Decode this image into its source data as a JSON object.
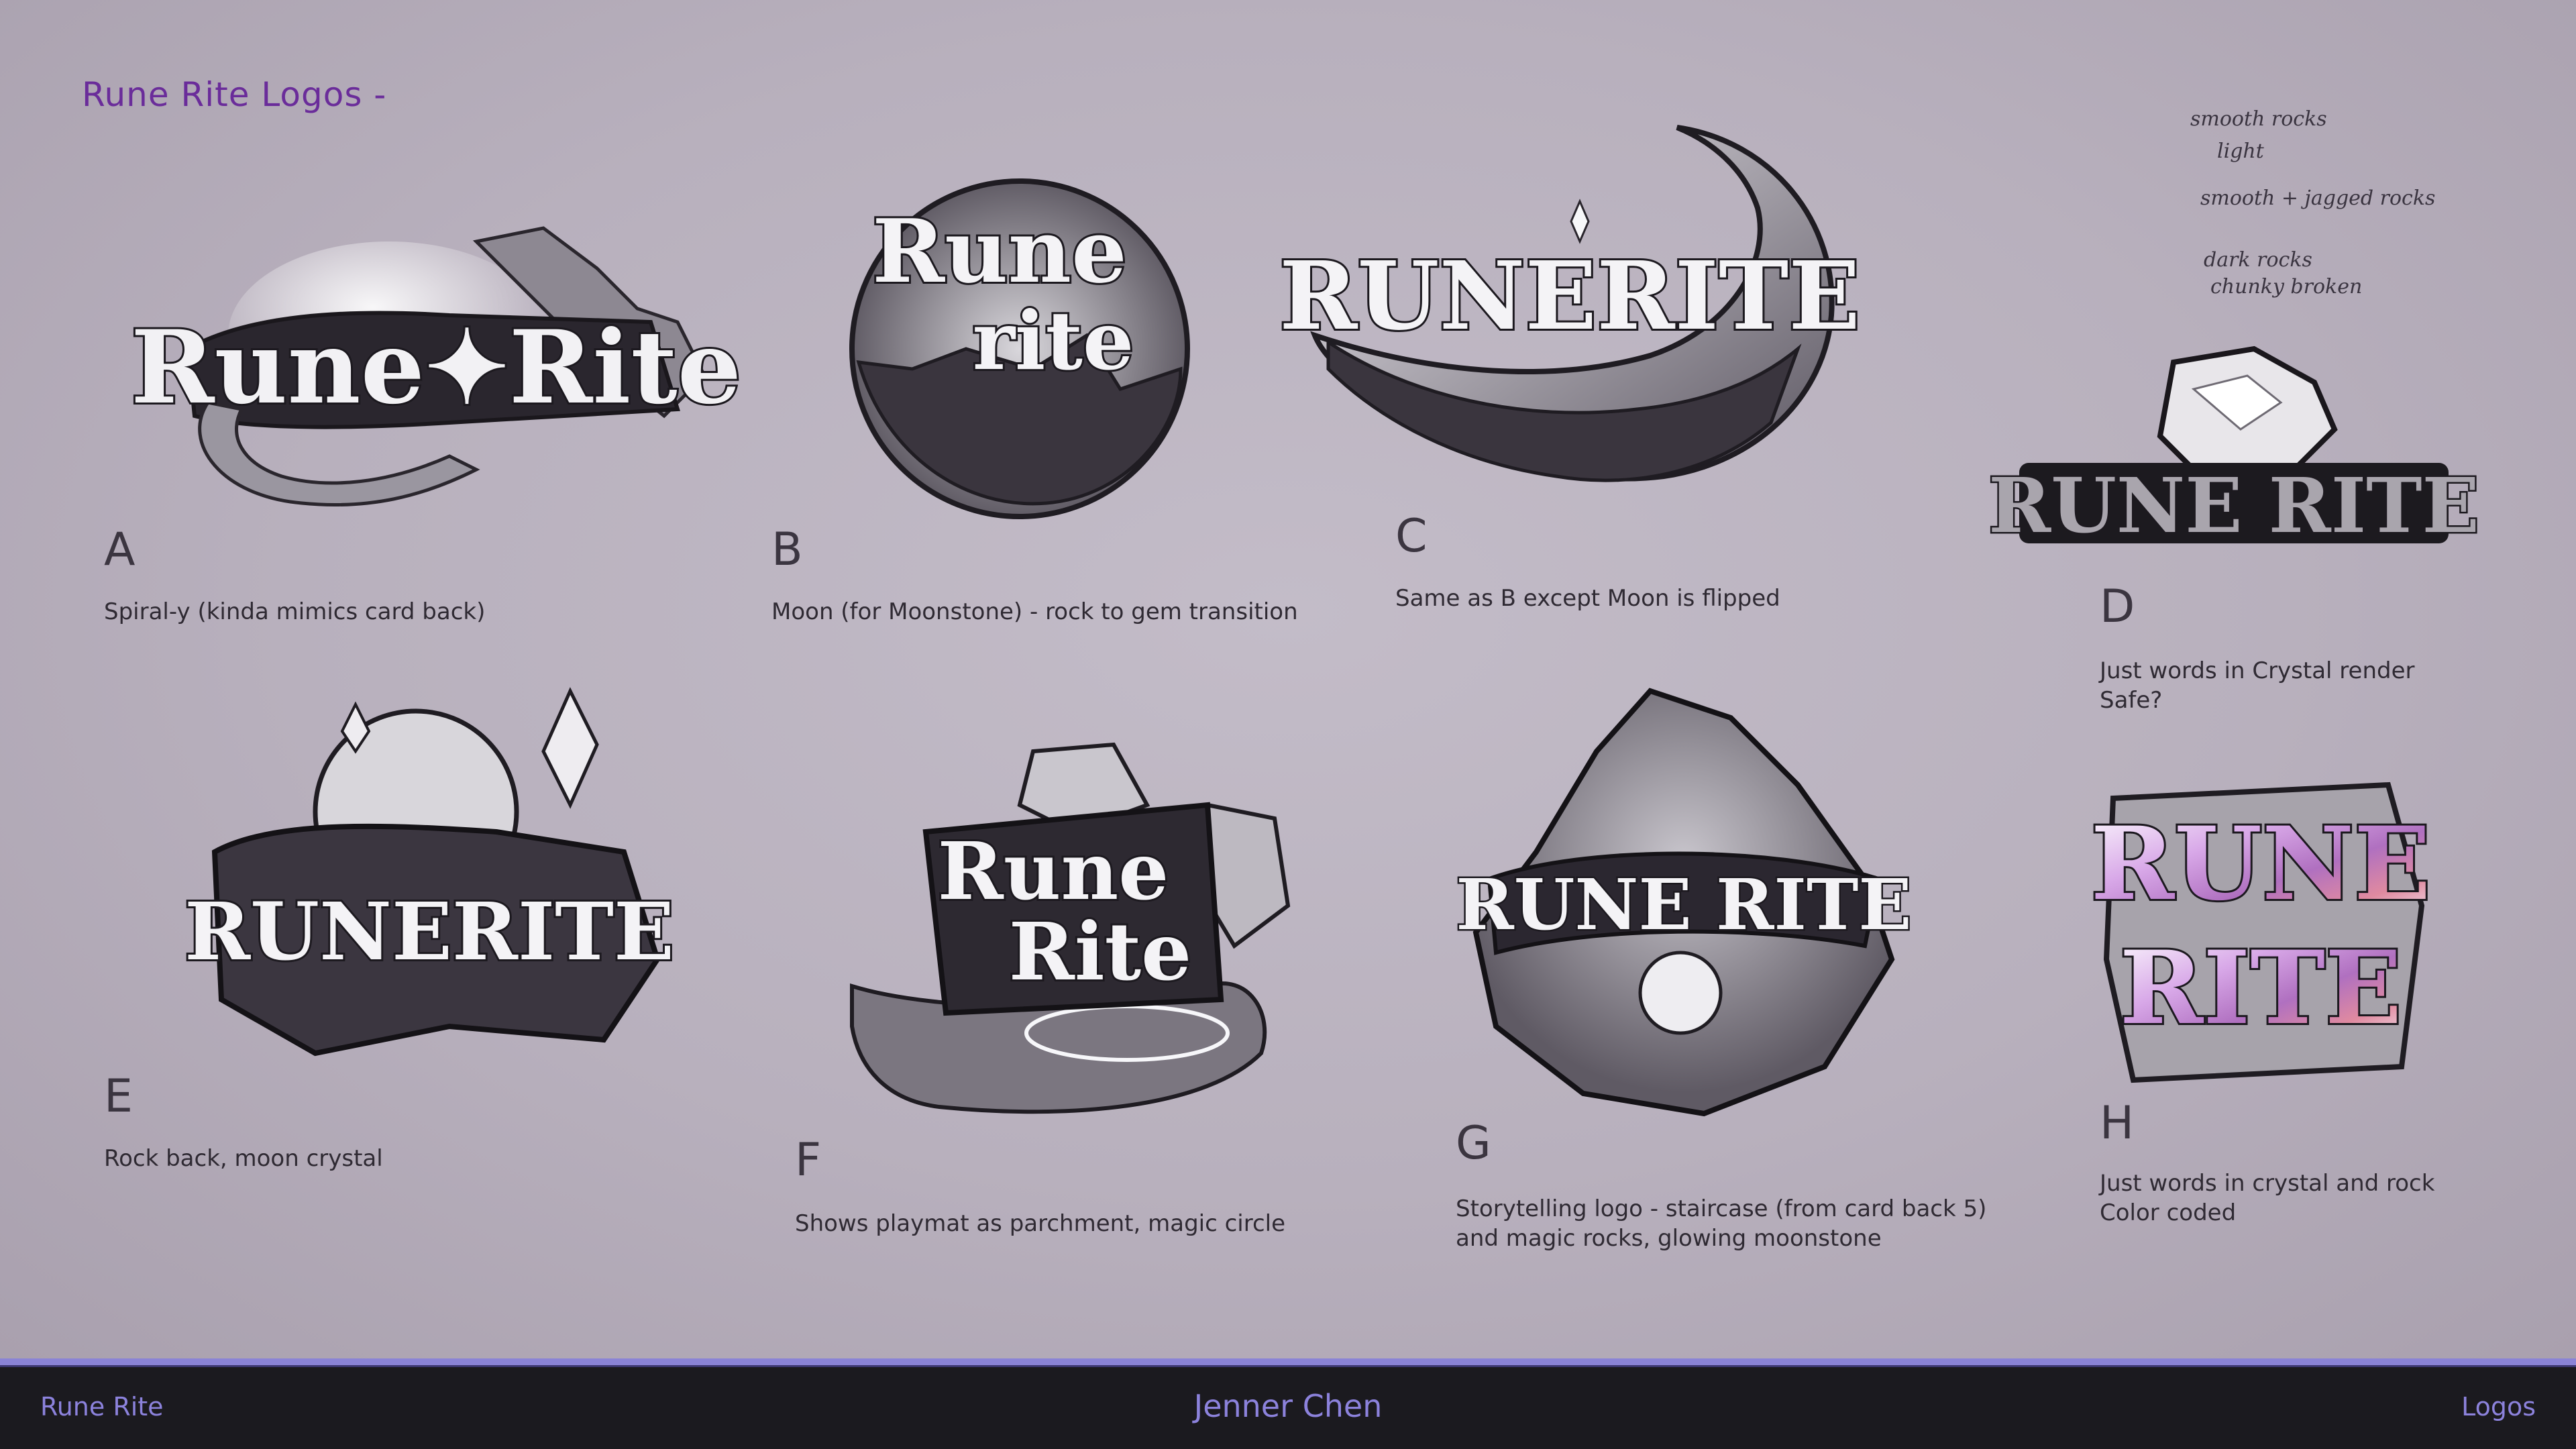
{
  "sheet": {
    "title": "Rune Rite Logos -",
    "concepts": [
      {
        "id": "A",
        "wordmark": "Rune✦Rite",
        "caption": [
          "Spiral-y (kinda mimics card back)"
        ]
      },
      {
        "id": "B",
        "wordmark_line1": "Rune",
        "wordmark_line2": "rite",
        "caption": [
          "Moon (for Moonstone) - rock to gem transition"
        ]
      },
      {
        "id": "C",
        "wordmark": "RUNERITE",
        "caption": [
          "Same as B except Moon is flipped"
        ]
      },
      {
        "id": "D",
        "wordmark": "RUNE RITE",
        "caption": [
          "Just words in Crystal render",
          "Safe?"
        ]
      },
      {
        "id": "E",
        "wordmark": "RUNERITE",
        "caption": [
          "Rock back, moon crystal"
        ]
      },
      {
        "id": "F",
        "wordmark_line1": "Rune",
        "wordmark_line2": "Rite",
        "caption": [
          "Shows playmat as parchment, magic circle"
        ]
      },
      {
        "id": "G",
        "wordmark": "RUNE RITE",
        "caption": [
          "Storytelling logo - staircase (from card back 5)",
          "and magic rocks, glowing moonstone"
        ]
      },
      {
        "id": "H",
        "wordmark_line1": "RUNE",
        "wordmark_line2": "RITE",
        "caption": [
          "Just words in crystal and rock",
          "Color coded"
        ]
      }
    ],
    "handwritten_notes": [
      "smooth rocks",
      "light",
      "smooth + jagged rocks",
      "dark rocks",
      "chunky broken"
    ]
  },
  "footer": {
    "left": "Rune Rite",
    "center": "Jenner Chen",
    "right": "Logos",
    "accent_color": "#8a83d6",
    "text_color": "#8c82dc"
  }
}
